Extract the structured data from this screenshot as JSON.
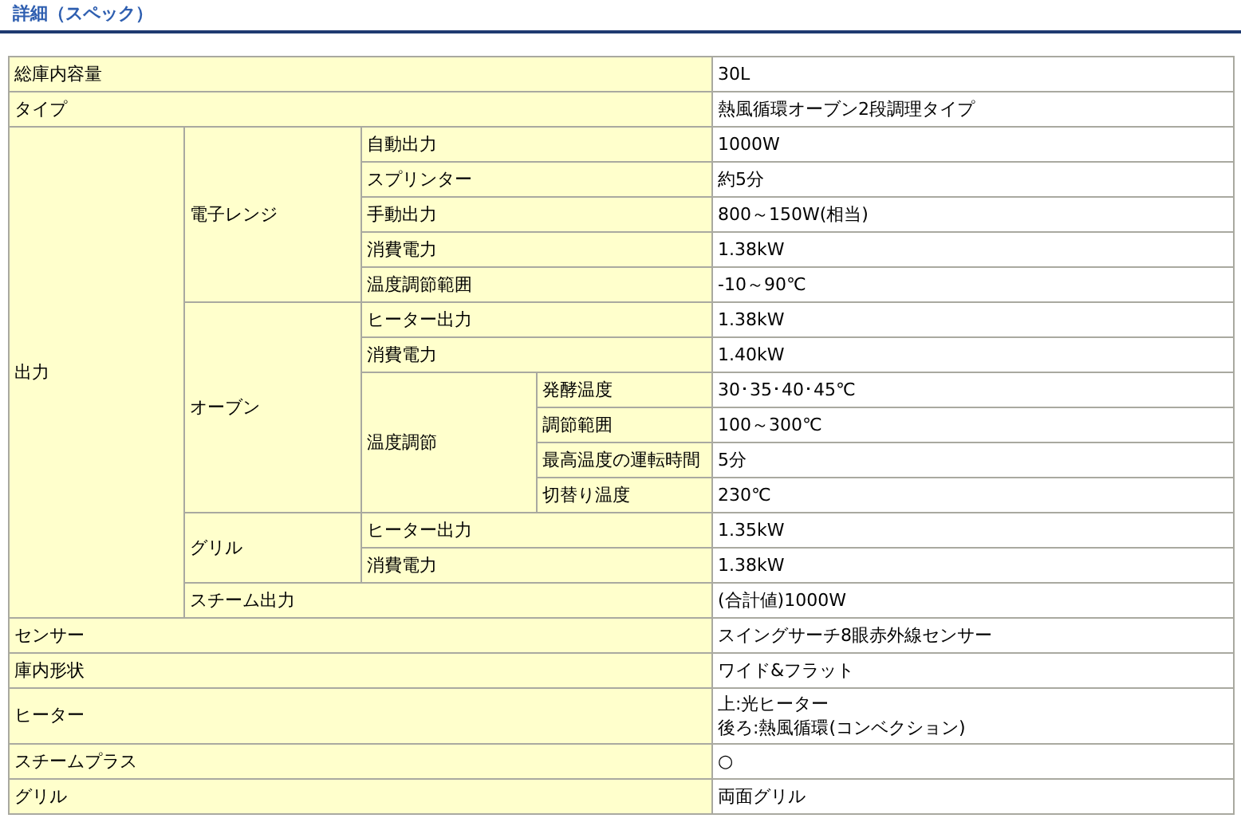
{
  "heading": "詳細（スペック）",
  "rows": [
    {
      "label": "総庫内容量",
      "value": "30L"
    },
    {
      "label": "タイプ",
      "value": "熱風循環オーブン2段調理タイプ"
    },
    {
      "label": "出力",
      "children": [
        {
          "label": "電子レンジ",
          "children": [
            {
              "label": "自動出力",
              "value": "1000W"
            },
            {
              "label": "スプリンター",
              "value": "約5分"
            },
            {
              "label": "手動出力",
              "value": "800～150W(相当)"
            },
            {
              "label": "消費電力",
              "value": "1.38kW"
            },
            {
              "label": "温度調節範囲",
              "value": "-10～90℃"
            }
          ]
        },
        {
          "label": "オーブン",
          "children": [
            {
              "label": "ヒーター出力",
              "value": "1.38kW"
            },
            {
              "label": "消費電力",
              "value": "1.40kW"
            },
            {
              "label": "温度調節",
              "children": [
                {
                  "label": "発酵温度",
                  "value": "30･35･40･45℃"
                },
                {
                  "label": "調節範囲",
                  "value": "100～300℃"
                },
                {
                  "label": "最高温度の運転時間",
                  "value": "5分"
                },
                {
                  "label": "切替り温度",
                  "value": "230℃"
                }
              ]
            }
          ]
        },
        {
          "label": "グリル",
          "children": [
            {
              "label": "ヒーター出力",
              "value": "1.35kW"
            },
            {
              "label": "消費電力",
              "value": "1.38kW"
            }
          ]
        },
        {
          "label": "スチーム出力",
          "value": "(合計値)1000W"
        }
      ]
    },
    {
      "label": "センサー",
      "value": "スイングサーチ8眼赤外線センサー"
    },
    {
      "label": "庫内形状",
      "value": "ワイド&フラット"
    },
    {
      "label": "ヒーター",
      "value_lines": [
        "上:光ヒーター",
        "後ろ:熱風循環(コンベクション)"
      ]
    },
    {
      "label": "スチームプラス",
      "value": "○"
    },
    {
      "label": "グリル",
      "value": "両面グリル"
    }
  ]
}
